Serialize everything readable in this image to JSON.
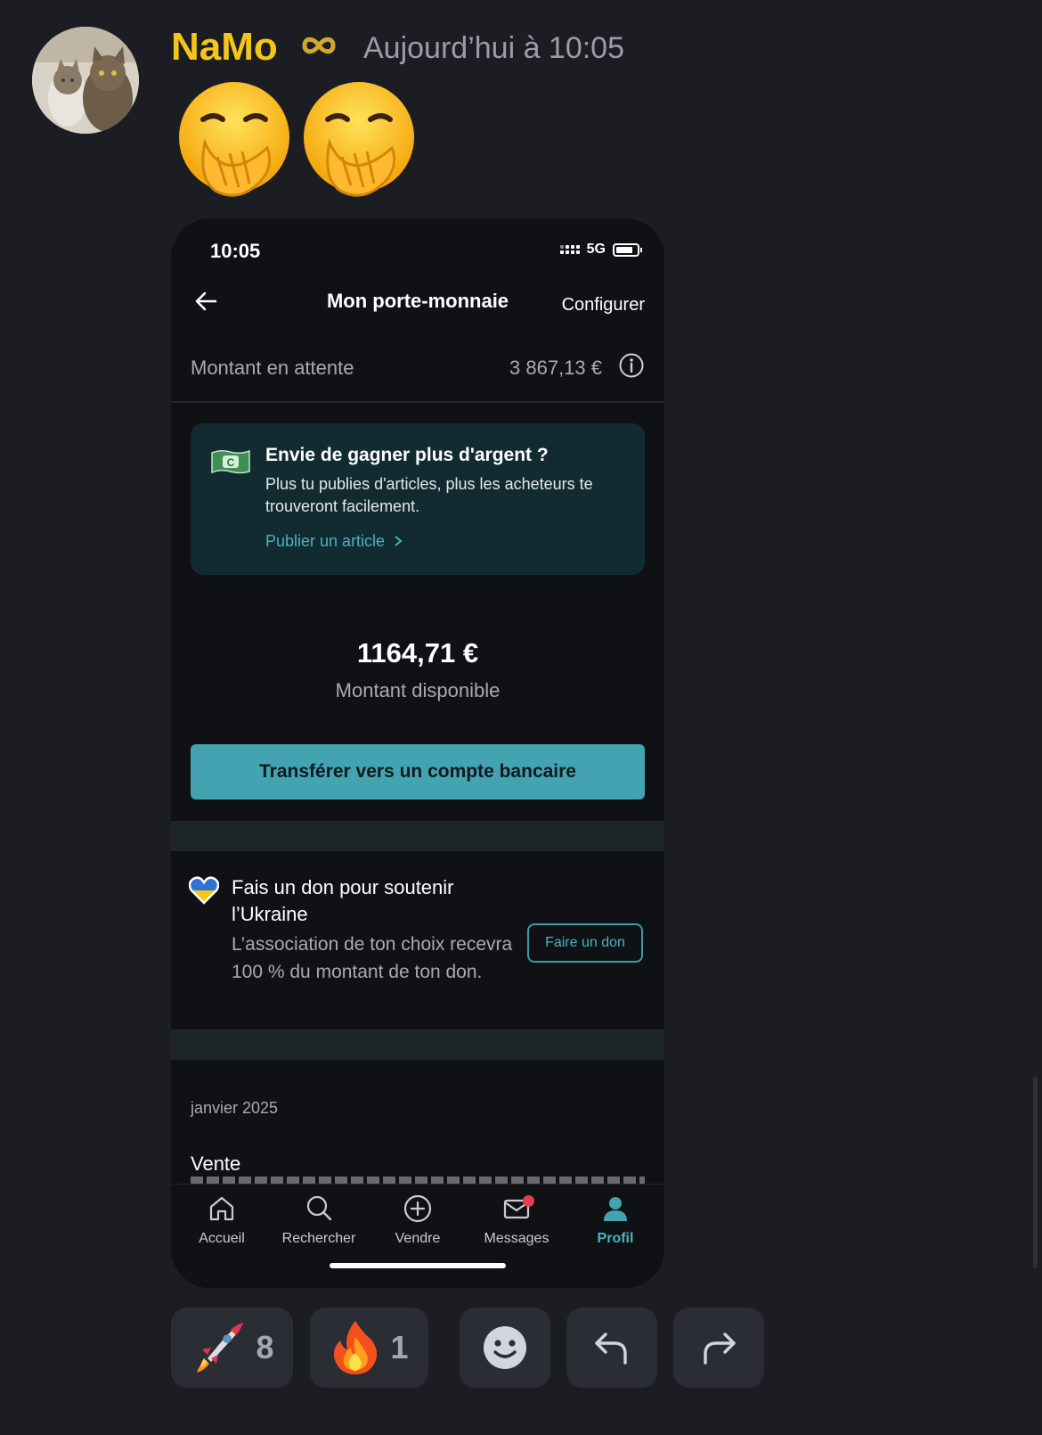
{
  "message": {
    "username": "NaMo",
    "timestamp": "Aujourd’hui à 10:05",
    "emojis": [
      "face-with-hand-over-mouth",
      "face-with-hand-over-mouth"
    ]
  },
  "phone": {
    "status": {
      "time": "10:05",
      "network": "5G"
    },
    "nav": {
      "title": "Mon porte-monnaie",
      "config": "Configurer"
    },
    "pending": {
      "label": "Montant en attente",
      "value": "3 867,13 €"
    },
    "promo": {
      "title": "Envie de gagner plus d'argent ?",
      "text": "Plus tu publies d'articles, plus les acheteurs te trouveront facilement.",
      "link": "Publier un article",
      "bill_letter": "C"
    },
    "balance": {
      "amount": "1164,71 €",
      "label": "Montant disponible"
    },
    "transfer_button": "Transférer vers un compte bancaire",
    "donation": {
      "title": "Fais un don pour soutenir l’Ukraine",
      "text": "L’association de ton choix recevra 100 % du montant de ton don.",
      "button": "Faire un don"
    },
    "history": {
      "month": "janvier 2025",
      "first_item": "Vente"
    },
    "tabs": [
      {
        "label": "Accueil",
        "icon": "home-icon"
      },
      {
        "label": "Rechercher",
        "icon": "search-icon"
      },
      {
        "label": "Vendre",
        "icon": "plus-circle-icon"
      },
      {
        "label": "Messages",
        "icon": "mail-icon"
      },
      {
        "label": "Profil",
        "icon": "profile-icon"
      }
    ],
    "colors": {
      "accent": "#44a3b0",
      "promo_bg": "#122b31",
      "background": "#101114"
    }
  },
  "reactions": [
    {
      "emoji": "rocket",
      "count": "8"
    },
    {
      "emoji": "fire",
      "count": "1"
    }
  ],
  "actions": [
    "add-reaction",
    "reply",
    "forward"
  ],
  "colors": {
    "background": "#1c1d23",
    "username": "#f5c518",
    "reaction_bg": "#2b2d35"
  }
}
